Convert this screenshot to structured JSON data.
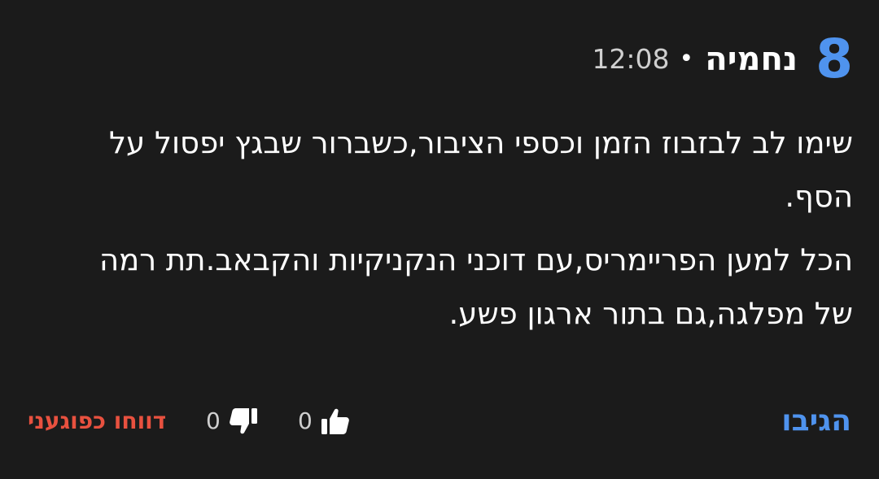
{
  "comment": {
    "number": "8",
    "author": "נחמיה",
    "separator": "•",
    "time": "12:08",
    "paragraphs": [
      "שימו לב לבזבוז הזמן וכספי הציבור,כשברור שבגץ יפסול על הסף.",
      "הכל למען הפריימריס,עם דוכני הנקניקיות והקבאב.תת רמה של מפלגה,גם בתור ארגון פשע."
    ]
  },
  "actions": {
    "reply_label": "הגיבו",
    "likes": "0",
    "dislikes": "0",
    "report_label": "דווחו כפוגעני",
    "icons": {
      "like": "thumbs-up-icon",
      "dislike": "thumbs-down-icon"
    }
  },
  "colors": {
    "background": "#1b1b1b",
    "accent": "#4f93ee",
    "report": "#e8513f",
    "muted": "#cfcfcf"
  }
}
